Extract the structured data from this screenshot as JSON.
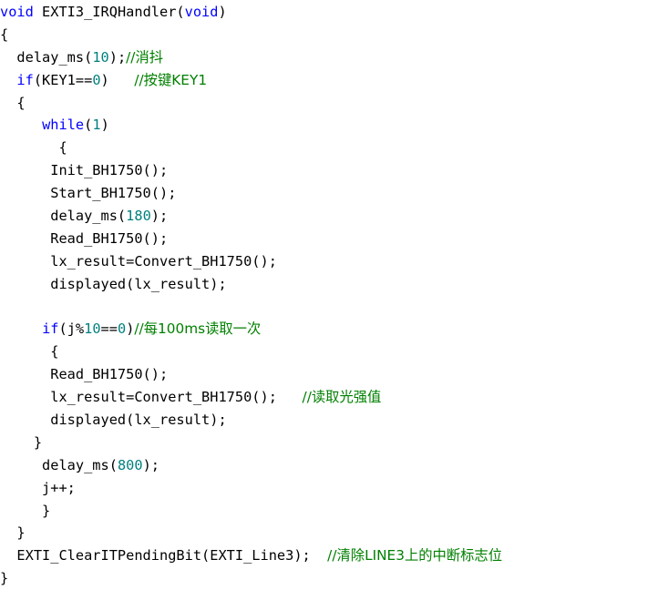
{
  "editor": {
    "name": "code-snippet-view",
    "language": "C",
    "background_color": "#ffffff",
    "colors": {
      "plain": "#000000",
      "keyword": "#0000ff",
      "number": "#007f7f",
      "comment": "#008000"
    }
  },
  "code": {
    "lines": [
      {
        "index": 0,
        "tokens": [
          {
            "t": "void",
            "k": "keyword"
          },
          {
            "t": " EXTI3_IRQHandler(",
            "k": "plain"
          },
          {
            "t": "void",
            "k": "keyword"
          },
          {
            "t": ")",
            "k": "plain"
          }
        ]
      },
      {
        "index": 1,
        "tokens": [
          {
            "t": "{",
            "k": "plain"
          }
        ]
      },
      {
        "index": 2,
        "tokens": [
          {
            "t": "  delay_ms(",
            "k": "plain"
          },
          {
            "t": "10",
            "k": "number"
          },
          {
            "t": ");",
            "k": "plain"
          },
          {
            "t": "//消抖",
            "k": "cjk"
          }
        ]
      },
      {
        "index": 3,
        "tokens": [
          {
            "t": "  ",
            "k": "plain"
          },
          {
            "t": "if",
            "k": "keyword"
          },
          {
            "t": "(KEY1==",
            "k": "plain"
          },
          {
            "t": "0",
            "k": "number"
          },
          {
            "t": ")   ",
            "k": "plain"
          },
          {
            "t": "//按键KEY1",
            "k": "cjk"
          }
        ]
      },
      {
        "index": 4,
        "tokens": [
          {
            "t": "  {",
            "k": "plain"
          }
        ]
      },
      {
        "index": 5,
        "tokens": [
          {
            "t": "     ",
            "k": "plain"
          },
          {
            "t": "while",
            "k": "keyword"
          },
          {
            "t": "(",
            "k": "plain"
          },
          {
            "t": "1",
            "k": "number"
          },
          {
            "t": ")",
            "k": "plain"
          }
        ]
      },
      {
        "index": 6,
        "tokens": [
          {
            "t": "       {",
            "k": "plain"
          }
        ]
      },
      {
        "index": 7,
        "tokens": [
          {
            "t": "      Init_BH1750();",
            "k": "plain"
          }
        ]
      },
      {
        "index": 8,
        "tokens": [
          {
            "t": "      Start_BH1750();",
            "k": "plain"
          }
        ]
      },
      {
        "index": 9,
        "tokens": [
          {
            "t": "      delay_ms(",
            "k": "plain"
          },
          {
            "t": "180",
            "k": "number"
          },
          {
            "t": ");",
            "k": "plain"
          }
        ]
      },
      {
        "index": 10,
        "tokens": [
          {
            "t": "      Read_BH1750();",
            "k": "plain"
          }
        ]
      },
      {
        "index": 11,
        "tokens": [
          {
            "t": "      lx_result=Convert_BH1750();",
            "k": "plain"
          }
        ]
      },
      {
        "index": 12,
        "tokens": [
          {
            "t": "      displayed(lx_result);",
            "k": "plain"
          }
        ]
      },
      {
        "index": 13,
        "tokens": [
          {
            "t": "",
            "k": "plain"
          }
        ]
      },
      {
        "index": 14,
        "tokens": [
          {
            "t": "     ",
            "k": "plain"
          },
          {
            "t": "if",
            "k": "keyword"
          },
          {
            "t": "(j%",
            "k": "plain"
          },
          {
            "t": "10",
            "k": "number"
          },
          {
            "t": "==",
            "k": "plain"
          },
          {
            "t": "0",
            "k": "number"
          },
          {
            "t": ")",
            "k": "plain"
          },
          {
            "t": "//每100ms读取一次",
            "k": "cjk"
          }
        ]
      },
      {
        "index": 15,
        "tokens": [
          {
            "t": "      {",
            "k": "plain"
          }
        ]
      },
      {
        "index": 16,
        "tokens": [
          {
            "t": "      Read_BH1750();",
            "k": "plain"
          }
        ]
      },
      {
        "index": 17,
        "tokens": [
          {
            "t": "      lx_result=Convert_BH1750();   ",
            "k": "plain"
          },
          {
            "t": "//读取光强值",
            "k": "cjk"
          }
        ]
      },
      {
        "index": 18,
        "tokens": [
          {
            "t": "      displayed(lx_result);",
            "k": "plain"
          }
        ]
      },
      {
        "index": 19,
        "tokens": [
          {
            "t": "    }",
            "k": "plain"
          }
        ]
      },
      {
        "index": 20,
        "tokens": [
          {
            "t": "     delay_ms(",
            "k": "plain"
          },
          {
            "t": "800",
            "k": "number"
          },
          {
            "t": ");",
            "k": "plain"
          }
        ]
      },
      {
        "index": 21,
        "tokens": [
          {
            "t": "     j++;",
            "k": "plain"
          }
        ]
      },
      {
        "index": 22,
        "tokens": [
          {
            "t": "     }",
            "k": "plain"
          }
        ]
      },
      {
        "index": 23,
        "tokens": [
          {
            "t": "  }",
            "k": "plain"
          }
        ]
      },
      {
        "index": 24,
        "tokens": [
          {
            "t": "  EXTI_ClearITPendingBit(EXTI_Line3);  ",
            "k": "plain"
          },
          {
            "t": "//清除LINE3上的中断标志位",
            "k": "cjk"
          }
        ]
      },
      {
        "index": 25,
        "tokens": [
          {
            "t": "}",
            "k": "plain"
          }
        ]
      }
    ]
  }
}
